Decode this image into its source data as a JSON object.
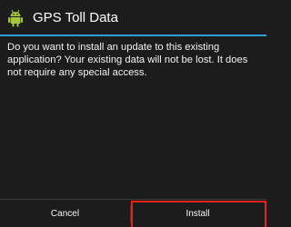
{
  "dialog": {
    "title": "GPS Toll Data",
    "app_icon": "android-robot-icon",
    "message": "Do you want to install an update to this existing application? Your existing data will not be lost. It does not require any special access."
  },
  "buttons": {
    "cancel_label": "Cancel",
    "install_label": "Install"
  },
  "colors": {
    "background": "#1c1c1c",
    "divider": "#2f9fd4",
    "highlight": "#e8231c",
    "android_green": "#a4c639"
  }
}
